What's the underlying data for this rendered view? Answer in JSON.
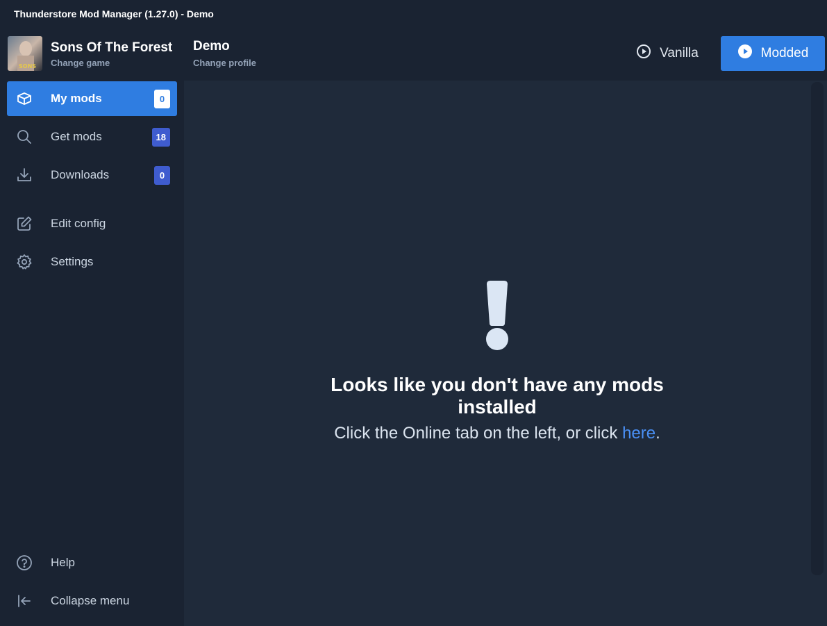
{
  "window": {
    "title": "Thunderstore Mod Manager (1.27.0) - Demo"
  },
  "header": {
    "game_title": "Sons Of The Forest",
    "game_action": "Change game",
    "game_thumb_text": "SONS",
    "profile_title": "Demo",
    "profile_action": "Change profile",
    "vanilla_label": "Vanilla",
    "modded_label": "Modded"
  },
  "sidebar": {
    "items": [
      {
        "label": "My mods",
        "badge": "0",
        "icon": "box-icon",
        "active": true
      },
      {
        "label": "Get mods",
        "badge": "18",
        "icon": "search-icon"
      },
      {
        "label": "Downloads",
        "badge": "0",
        "icon": "download-icon"
      },
      {
        "label": "Edit config",
        "icon": "edit-icon"
      },
      {
        "label": "Settings",
        "icon": "gear-icon"
      }
    ],
    "bottom": [
      {
        "label": "Help",
        "icon": "help-icon"
      },
      {
        "label": "Collapse menu",
        "icon": "collapse-icon"
      }
    ]
  },
  "main": {
    "empty_title": "Looks like you don't have any mods installed",
    "empty_sub_before": "Click the Online tab on the left, or click ",
    "empty_link": "here",
    "empty_sub_after": "."
  },
  "colors": {
    "accent": "#2f7de1",
    "badge_blue": "#3f5ccf",
    "background": "#1a2332",
    "panel": "#1f2a3a",
    "link": "#4a90f5"
  }
}
